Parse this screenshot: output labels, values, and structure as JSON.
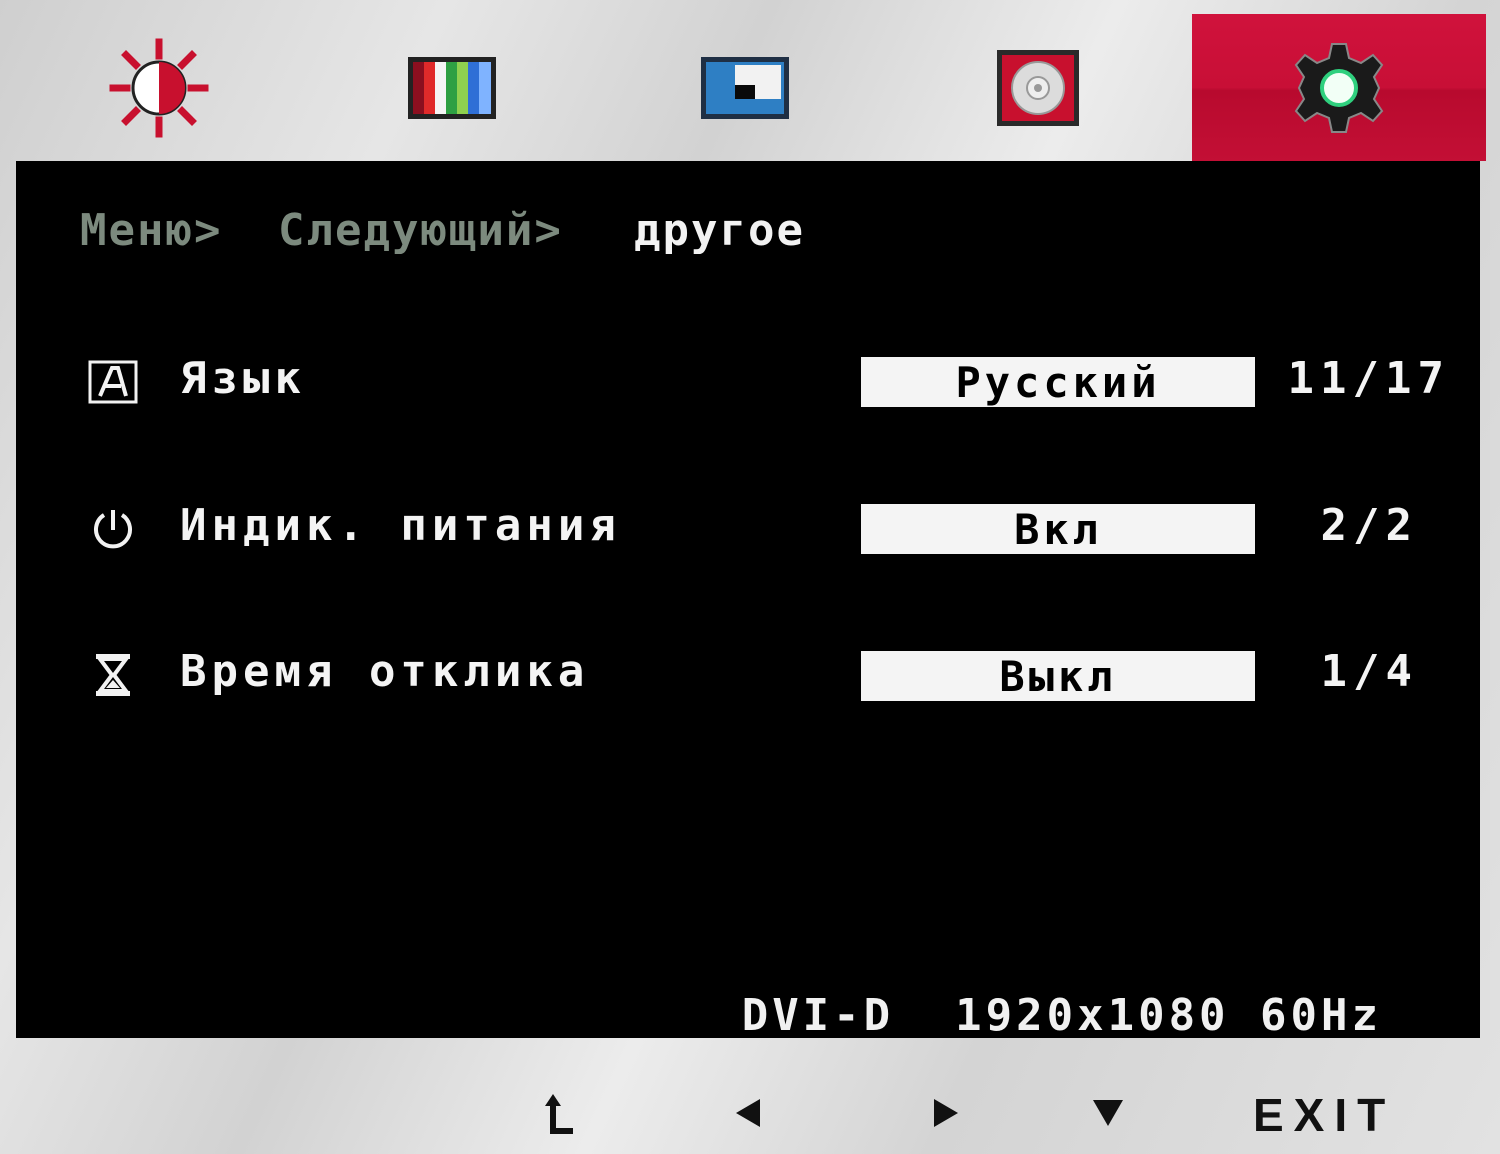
{
  "tabs": [
    {
      "icon": "brightness-icon",
      "active": false
    },
    {
      "icon": "color-bars-icon",
      "active": false
    },
    {
      "icon": "picture-window-icon",
      "active": false
    },
    {
      "icon": "disc-icon",
      "active": false
    },
    {
      "icon": "gear-icon",
      "active": true
    }
  ],
  "breadcrumb": {
    "root": "Меню>",
    "middle": "Следующий>",
    "current": "другое"
  },
  "settings": [
    {
      "icon": "language-a-icon",
      "label": "Язык",
      "value": "Русский",
      "index": "11/17"
    },
    {
      "icon": "power-icon",
      "label": "Индик. питания",
      "value": "Вкл",
      "index": "2/2"
    },
    {
      "icon": "hourglass-icon",
      "label": "Время отклика",
      "value": "Выкл",
      "index": "1/4"
    }
  ],
  "status": "DVI-D  1920x1080 60Hz",
  "nav": {
    "back_icon": "return-arrow-icon",
    "left_icon": "left-arrow-icon",
    "right_icon": "right-arrow-icon",
    "down_icon": "down-arrow-icon",
    "exit_label": "EXIT"
  },
  "colors": {
    "active_tab": "#c8103a",
    "panel_bg": "#000000",
    "value_box": "#f4f4f4",
    "dim_text": "#7c8a7e"
  }
}
